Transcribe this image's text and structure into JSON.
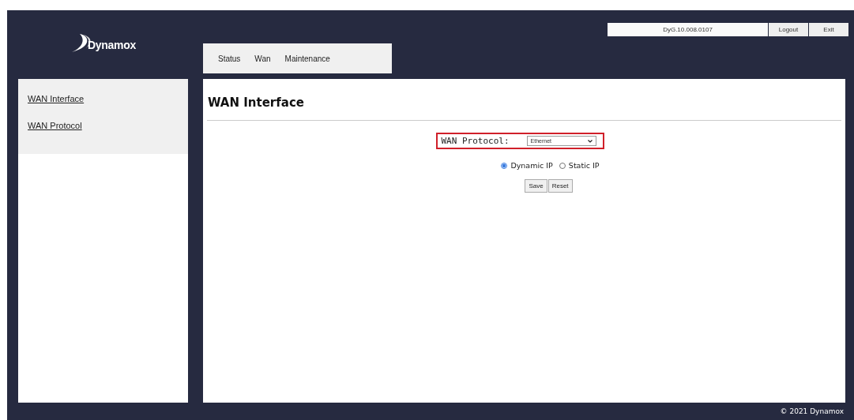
{
  "logo": {
    "text": "Dynamox"
  },
  "header": {
    "version": "DyG.10.008.0107",
    "buttons": [
      "Logout",
      "Exit"
    ]
  },
  "tabs": [
    {
      "label": "Status"
    },
    {
      "label": "Wan"
    },
    {
      "label": "Maintenance"
    }
  ],
  "sidebar": {
    "items": [
      {
        "label": "WAN Interface"
      },
      {
        "label": "WAN Protocol"
      }
    ]
  },
  "content": {
    "title": "WAN Interface",
    "protocol": {
      "label": "WAN Protocol:",
      "value": "Ethernet"
    },
    "radios": [
      {
        "label": "Dynamic IP",
        "selected": true
      },
      {
        "label": "Static IP",
        "selected": false
      }
    ],
    "buttons": [
      "Save",
      "Reset"
    ]
  },
  "footer": "© 2021 Dynamox"
}
